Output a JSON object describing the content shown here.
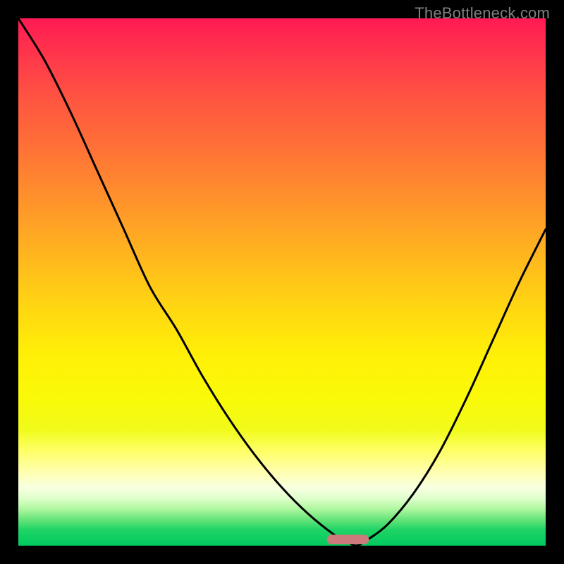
{
  "watermark": "TheBottleneck.com",
  "chart_data": {
    "type": "line",
    "title": "",
    "xlabel": "",
    "ylabel": "",
    "xlim": [
      0,
      100
    ],
    "ylim": [
      0,
      100
    ],
    "grid": false,
    "series": [
      {
        "name": "curve",
        "x": [
          0,
          5,
          10,
          15,
          20,
          25,
          30,
          35,
          40,
          45,
          50,
          55,
          60,
          62,
          64,
          66,
          70,
          75,
          80,
          85,
          90,
          95,
          100
        ],
        "values": [
          100,
          92,
          82,
          71,
          60,
          49,
          41,
          32,
          24,
          17,
          11,
          6,
          2,
          1,
          0,
          1,
          4,
          10,
          18,
          28,
          39,
          50,
          60
        ]
      }
    ],
    "annotations": {
      "dip_marker": {
        "x_center": 62.5,
        "width": 8,
        "height": 1.8
      }
    },
    "background_gradient": {
      "direction": "vertical_top_to_bottom",
      "stops": [
        {
          "pos": 0.0,
          "color": "#ff1a53"
        },
        {
          "pos": 0.25,
          "color": "#ff7a33"
        },
        {
          "pos": 0.55,
          "color": "#ffda10"
        },
        {
          "pos": 0.85,
          "color": "#ffffb0"
        },
        {
          "pos": 1.0,
          "color": "#00c95e"
        }
      ]
    }
  }
}
